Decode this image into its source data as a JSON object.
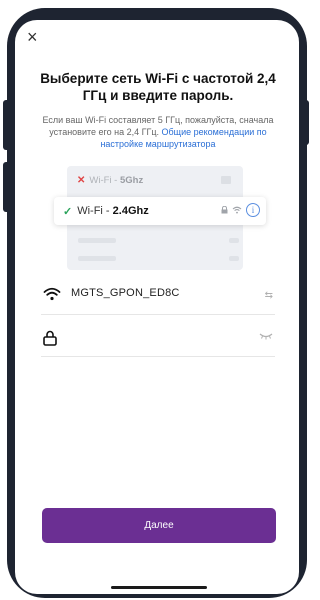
{
  "dialog": {
    "close_label": "×",
    "title": "Выберите сеть Wi-Fi с частотой 2,4 ГГц и введите пароль.",
    "subtitle_text": "Если ваш Wi-Fi составляет 5 ГГц, пожалуйста, сначала установите его на 2,4 ГГц.",
    "subtitle_link": "Общие рекомендации по настройке маршрутизатора"
  },
  "illustration": {
    "bad_network_prefix": "Wi-Fi - ",
    "bad_network_band": "5Ghz",
    "good_network_prefix": "Wi-Fi - ",
    "good_network_band": "2.4Ghz",
    "bad_mark": "✕",
    "good_mark": "✓",
    "info_glyph": "i"
  },
  "form": {
    "ssid_value": "MGTS_GPON_ED8C",
    "password_value": "",
    "swap_glyph": "⇆"
  },
  "next_button_label": "Далее",
  "icons": {
    "wifi": "wifi-icon",
    "lock": "lock-icon",
    "eye": "eye-closed-icon",
    "swap": "swap-network-icon"
  }
}
